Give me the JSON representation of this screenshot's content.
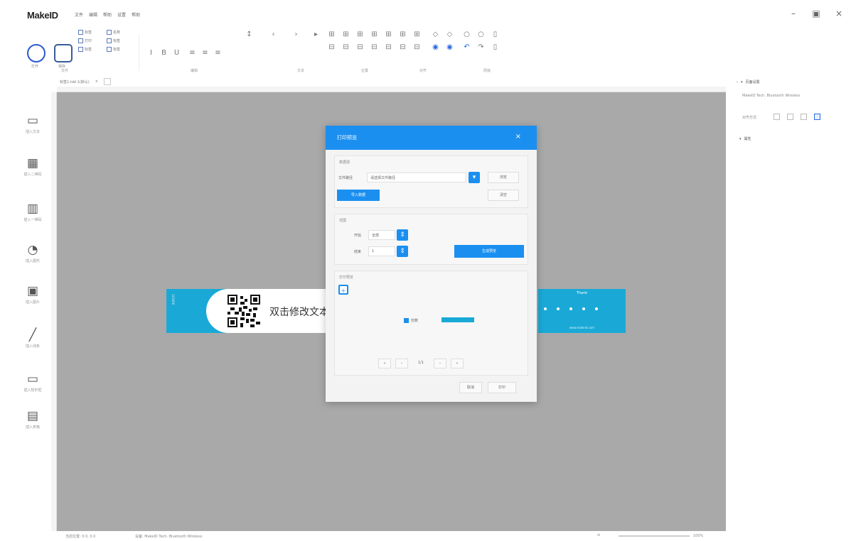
{
  "app": {
    "logo": "MakeID",
    "menu": [
      "文件",
      "编辑",
      "帮助",
      "设置",
      "帮助"
    ],
    "window_controls": [
      "–",
      "▣",
      "×"
    ]
  },
  "ribbon": {
    "big_buttons": [
      "打开",
      "保存"
    ],
    "checks_col1": [
      "标签",
      "打印",
      "标签"
    ],
    "checks_col2": [
      "名称",
      "标签",
      "标签"
    ],
    "groups": [
      "文件",
      "编辑",
      "文本",
      "位置",
      "对齐",
      "层级"
    ]
  },
  "doc_tab": {
    "label": "标签1.tdd 1(默认)",
    "close": "×"
  },
  "tools": [
    {
      "icon": "▭",
      "label": "插入文本"
    },
    {
      "icon": "▦",
      "label": "插入二维码"
    },
    {
      "icon": "▥",
      "label": "插入一维码"
    },
    {
      "icon": "◔",
      "label": "插入图形"
    },
    {
      "icon": "▣",
      "label": "插入图片"
    },
    {
      "icon": "╱",
      "label": "插入线条"
    },
    {
      "icon": "▭",
      "label": "插入矩形框"
    },
    {
      "icon": "▤",
      "label": "插入表格"
    }
  ],
  "label": {
    "text": "双击修改文本",
    "right_header": "Thank",
    "right_footer": "www.makeid.com"
  },
  "dialog": {
    "title": "打印预览",
    "close": "×",
    "section1_title": "数据源",
    "file_label": "文件路径",
    "file_value": "请选择文件路径",
    "browse_button": "浏览",
    "clear_button": "清空",
    "import_button": "导入数据",
    "section2_title": "范围",
    "start_label": "开始",
    "start_value": "全部",
    "end_label": "结束",
    "end_value": "1",
    "generate_button": "生成预览",
    "section3_title": "打印预览",
    "copies_label": "份数",
    "pager": [
      "«",
      "‹",
      "1/1",
      "›",
      "»"
    ],
    "cancel_button": "取消",
    "print_button": "打印"
  },
  "right_panel": {
    "section1": "页面设置",
    "section1_sub": "MakeID Tech. Bluetooth Wireless",
    "align_label": "对齐方式",
    "section2": "属性"
  },
  "status": {
    "left1": "当前位置: 0.0, 0.0",
    "left2": "设备: MakeID Tech. Bluetooth Wireless",
    "zoom": "100%"
  }
}
